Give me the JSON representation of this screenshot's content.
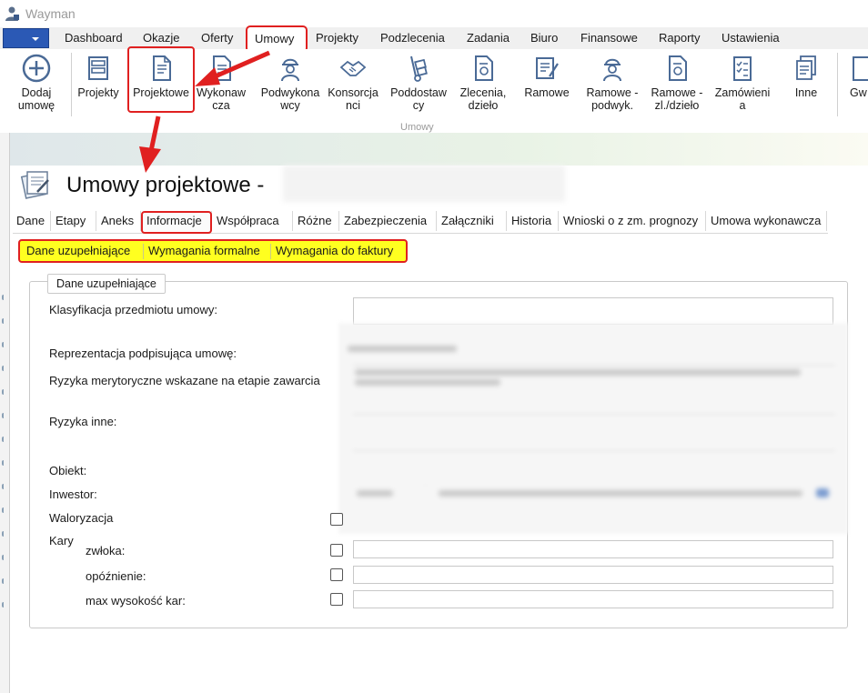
{
  "app": {
    "title": "Wayman"
  },
  "menu": {
    "items": [
      {
        "label": "Dashboard"
      },
      {
        "label": "Okazje"
      },
      {
        "label": "Oferty"
      },
      {
        "label": "Umowy"
      },
      {
        "label": "Projekty"
      },
      {
        "label": "Podzlecenia"
      },
      {
        "label": "Zadania"
      },
      {
        "label": "Biuro"
      },
      {
        "label": "Finansowe"
      },
      {
        "label": "Raporty"
      },
      {
        "label": "Ustawienia"
      }
    ],
    "active": "Umowy"
  },
  "ribbon": {
    "group_label": "Umowy",
    "buttons": [
      {
        "label": "Dodaj umowę",
        "icon": "plus-circle-icon"
      },
      {
        "label": "Projekty",
        "icon": "cabinet-icon"
      },
      {
        "label": "Projektowe",
        "icon": "document-icon"
      },
      {
        "label": "Wykonawcza",
        "icon": "document-icon"
      },
      {
        "label": "Podwykonawcy",
        "icon": "worker-icon"
      },
      {
        "label": "Konsorcjanci",
        "icon": "handshake-icon"
      },
      {
        "label": "Poddostawcy",
        "icon": "hand-truck-icon"
      },
      {
        "label": "Zlecenia, dzieło",
        "icon": "document-seal-icon"
      },
      {
        "label": "Ramowe",
        "icon": "document-pen-icon"
      },
      {
        "label": "Ramowe - podwyk.",
        "icon": "worker-icon"
      },
      {
        "label": "Ramowe - zl./dzieło",
        "icon": "document-seal-icon"
      },
      {
        "label": "Zamówienia",
        "icon": "checklist-icon"
      },
      {
        "label": "Inne",
        "icon": "documents-stack-icon"
      },
      {
        "label": "Gw",
        "icon": "guarantee-icon"
      }
    ],
    "highlighted": "Projektowe"
  },
  "form": {
    "title": "Umowy projektowe -",
    "tabs": [
      {
        "label": "Dane"
      },
      {
        "label": "Etapy"
      },
      {
        "label": "Aneks"
      },
      {
        "label": "Informacje"
      },
      {
        "label": "Współpraca"
      },
      {
        "label": "Różne"
      },
      {
        "label": "Zabezpieczenia"
      },
      {
        "label": "Załączniki"
      },
      {
        "label": "Historia"
      },
      {
        "label": "Wnioski o z zm. prognozy"
      },
      {
        "label": "Umowa wykonawcza"
      }
    ],
    "active_tab": "Informacje",
    "subtabs": [
      {
        "label": "Dane uzupełniające"
      },
      {
        "label": "Wymagania formalne"
      },
      {
        "label": "Wymagania do faktury"
      }
    ],
    "active_subtab": "Dane uzupełniające",
    "fieldset_legend": "Dane uzupełniające",
    "fields": {
      "klasyfikacja": "Klasyfikacja przedmiotu umowy:",
      "reprezentacja": "Reprezentacja podpisująca umowę:",
      "ryzyka_merytoryczne": "Ryzyka merytoryczne wskazane na etapie zawarcia",
      "ryzyka_inne": "Ryzyka inne:",
      "obiekt": "Obiekt:",
      "inwestor": "Inwestor:",
      "waloryzacja": "Waloryzacja",
      "kary": "Kary",
      "zwloka": "zwłoka:",
      "opoznienie": "opóźnienie:",
      "max_kar": "max wysokość kar:"
    }
  },
  "colors": {
    "highlight_red": "#e02020",
    "subtab_yellow": "#ffff20",
    "menu_button_blue": "#2b59b5"
  }
}
